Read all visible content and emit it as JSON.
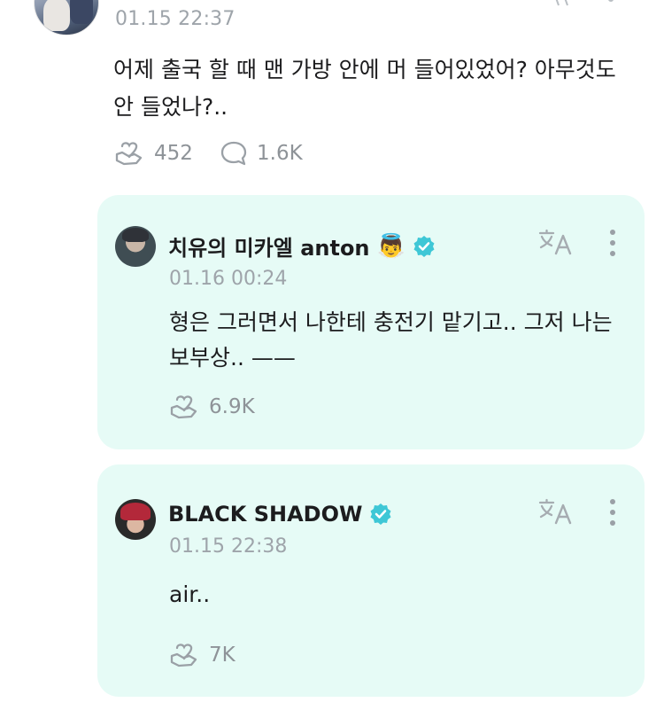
{
  "top_post": {
    "time": "01.15 22:37",
    "text": "어제 출국 할 때 맨 가방 안에 머 들어있었어? 아무것도 안 들었나?..",
    "likes": "452",
    "comments": "1.6K"
  },
  "replies": [
    {
      "author": "치유의 미카엘 anton",
      "badge_emoji": "👼",
      "verified": true,
      "time": "01.16 00:24",
      "text": "형은 그러면서 나한테 충전기 맡기고.. 그저 나는 보부상.. ——",
      "likes": "6.9K"
    },
    {
      "author": "BLACK SHADOW",
      "verified": true,
      "time": "01.15 22:38",
      "text": "air..",
      "likes": "7K"
    }
  ],
  "colors": {
    "card_bg": "#e6fbf6",
    "verified": "#3ec7d6",
    "muted": "#9ea4aa",
    "icon": "#8e9398"
  },
  "icons": {
    "like": "heart-hand-icon",
    "comment": "speech-bubble-icon",
    "translate": "translate-icon",
    "more": "more-vertical-icon",
    "verified": "verified-badge-icon"
  }
}
